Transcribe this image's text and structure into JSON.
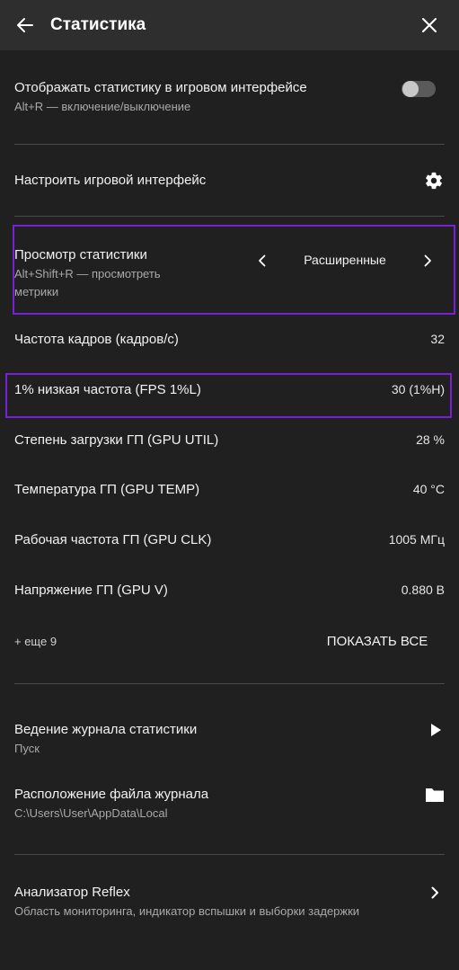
{
  "header": {
    "title": "Статистика",
    "back_icon": "arrow-left-icon",
    "close_icon": "close-icon"
  },
  "overlay": {
    "label": "Отображать статистику в игровом интерфейсе",
    "hint": "Alt+R — включение/выключение",
    "enabled": false
  },
  "customize": {
    "label": "Настроить игровой интерфейс",
    "icon": "gear-icon"
  },
  "view": {
    "label": "Просмотр статистики",
    "hint_line1": "Alt+Shift+R — просмотреть",
    "hint_line2": "метрики",
    "selected": "Расширенные"
  },
  "metrics": [
    {
      "label": "Частота кадров (кадров/с)",
      "value": "32"
    },
    {
      "label": "1% низкая частота (FPS 1%L)",
      "value": "30 (1%H)"
    },
    {
      "label": "Степень загрузки ГП (GPU UTIL)",
      "value": "28 %"
    },
    {
      "label": "Температура ГП (GPU TEMP)",
      "value": "40 °C"
    },
    {
      "label": "Рабочая частота ГП (GPU CLK)",
      "value": "1005 МГц"
    },
    {
      "label": "Напряжение ГП (GPU V)",
      "value": "0.880 В"
    }
  ],
  "more": {
    "label": "+ еще 9",
    "button": "ПОКАЗАТЬ ВСЕ"
  },
  "logging": {
    "label": "Ведение журнала статистики",
    "status": "Пуск",
    "icon": "play-icon"
  },
  "log_location": {
    "label": "Расположение файла журнала",
    "path": "C:\\Users\\User\\AppData\\Local",
    "icon": "folder-icon"
  },
  "reflex": {
    "label": "Анализатор Reflex",
    "description": "Область мониторинга, индикатор вспышки и выборки задержки",
    "icon": "chevron-right-icon"
  },
  "colors": {
    "background": "#202020",
    "header": "#2e2e2e",
    "highlight": "#7a1fd8"
  }
}
